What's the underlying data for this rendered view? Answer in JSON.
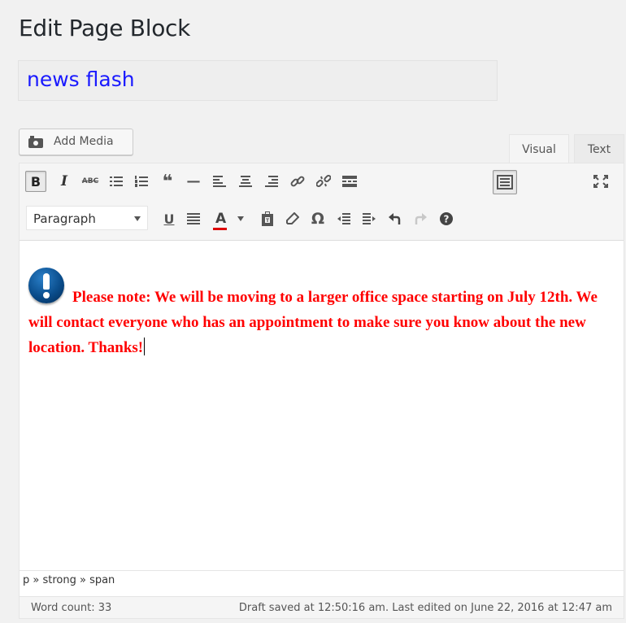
{
  "page": {
    "title": "Edit Page Block"
  },
  "title_field": {
    "value": "news flash"
  },
  "media": {
    "add_media_label": "Add Media"
  },
  "tabs": {
    "visual": "Visual",
    "text": "Text"
  },
  "toolbar": {
    "row1": [
      {
        "name": "bold-button",
        "glyph": "B",
        "active": true
      },
      {
        "name": "italic-button",
        "glyph": "I"
      },
      {
        "name": "strikethrough-button",
        "glyph": "ABC"
      },
      {
        "name": "bullet-list-button",
        "icon": "bullet-list-icon"
      },
      {
        "name": "numbered-list-button",
        "icon": "numbered-list-icon"
      },
      {
        "name": "blockquote-button",
        "glyph": "❝"
      },
      {
        "name": "horizontal-line-button",
        "glyph": "—"
      },
      {
        "name": "align-left-button",
        "icon": "align-left-icon"
      },
      {
        "name": "align-center-button",
        "icon": "align-center-icon"
      },
      {
        "name": "align-right-button",
        "icon": "align-right-icon"
      },
      {
        "name": "insert-link-button",
        "icon": "link-icon"
      },
      {
        "name": "remove-link-button",
        "icon": "unlink-icon"
      },
      {
        "name": "read-more-button",
        "icon": "read-more-icon"
      },
      {
        "name": "toolbar-toggle-button",
        "icon": "keyboard-icon",
        "active": true
      }
    ],
    "fullscreen_icon": "fullscreen-icon",
    "format_select": {
      "value": "Paragraph"
    },
    "row2": [
      {
        "name": "underline-button",
        "glyph": "U"
      },
      {
        "name": "justify-button",
        "icon": "justify-icon"
      },
      {
        "name": "text-color-button",
        "glyph": "A",
        "color": "#dd0000"
      },
      {
        "name": "paste-text-button",
        "icon": "clipboard-icon"
      },
      {
        "name": "clear-formatting-button",
        "icon": "eraser-icon"
      },
      {
        "name": "special-character-button",
        "glyph": "Ω"
      },
      {
        "name": "outdent-button",
        "icon": "outdent-icon"
      },
      {
        "name": "indent-button",
        "icon": "indent-icon"
      },
      {
        "name": "undo-button",
        "icon": "undo-icon"
      },
      {
        "name": "redo-button",
        "icon": "redo-icon"
      },
      {
        "name": "help-button",
        "icon": "help-icon"
      }
    ]
  },
  "content": {
    "text": "Please note:  We will be moving to a larger office space starting on July 12th.  We will contact everyone who has an appointment to make sure you know about the new location.  Thanks!",
    "color": "#ff0000",
    "icon": "info-icon"
  },
  "path": {
    "text": "p » strong » span"
  },
  "status": {
    "word_count": "Word count: 33",
    "saved": "Draft saved at 12:50:16 am. Last edited on June 22, 2016 at 12:47 am"
  }
}
